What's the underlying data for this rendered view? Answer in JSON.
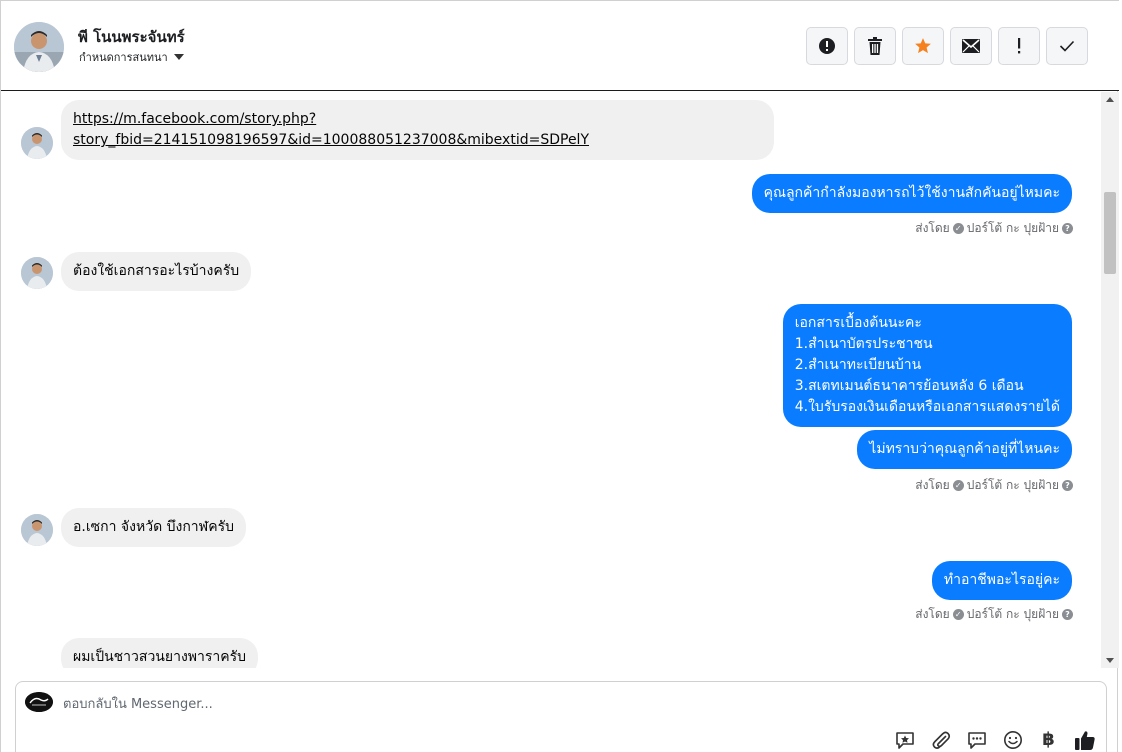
{
  "header": {
    "contact_name": "พี โนนพระจันทร์",
    "subtitle": "กำหนดการสนทนา"
  },
  "toolbar": {
    "buttons": [
      {
        "name": "spam",
        "icon": "alert-circle-icon"
      },
      {
        "name": "delete",
        "icon": "trash-icon"
      },
      {
        "name": "star",
        "icon": "star-icon",
        "color": "#f5811f"
      },
      {
        "name": "unread",
        "icon": "envelope-icon"
      },
      {
        "name": "important",
        "icon": "exclamation-icon"
      },
      {
        "name": "done",
        "icon": "check-icon"
      }
    ]
  },
  "messages": [
    {
      "dir": "in",
      "lines": [
        "https://m.facebook.com/story.php?",
        "story_fbid=214151098196597&id=100088051237008&mibextid=SDPelY"
      ],
      "link": true
    },
    {
      "dir": "out",
      "text": "คุณลูกค้ากำลังมองหารถไว้ใช้งานสักคันอยู่ไหมคะ"
    },
    {
      "dir": "in",
      "text": "ต้องใช้เอกสารอะไรบ้างครับ"
    },
    {
      "dir": "out",
      "lines": [
        "เอกสารเบื้องต้นนะคะ",
        "1.สำเนาบัตรประชาชน",
        "2.สำเนาทะเบียนบ้าน",
        "3.สเตทเมนต์ธนาคารย้อนหลัง 6 เดือน",
        "4.ใบรับรองเงินเดือนหรือเอกสารแสดงรายได้"
      ]
    },
    {
      "dir": "out",
      "text": "ไม่ทราบว่าคุณลูกค้าอยู่ที่ไหนคะ"
    },
    {
      "dir": "in",
      "text": "อ.เซกา จังหวัด บึงกาฬครับ"
    },
    {
      "dir": "out",
      "text": "ทำอาชีพอะไรอยู่คะ"
    },
    {
      "dir": "in",
      "text": "ผมเป็นชาวสวนยางพาราครับ"
    }
  ],
  "sent_by": {
    "label": "ส่งโดย",
    "sender": "ปอร์โต้ กะ ปุยฝ้าย"
  },
  "composer": {
    "placeholder": "ตอบกลับใน Messenger...",
    "tools": [
      "saved-reply-icon",
      "paperclip-icon",
      "chat-bubbles-icon",
      "smiley-icon",
      "baht-icon",
      "thumbs-up-icon"
    ],
    "baht_symbol": "฿"
  },
  "colors": {
    "outgoing_bubble": "#0a7cff",
    "incoming_bubble": "#f0f0f0",
    "star": "#f5811f"
  }
}
